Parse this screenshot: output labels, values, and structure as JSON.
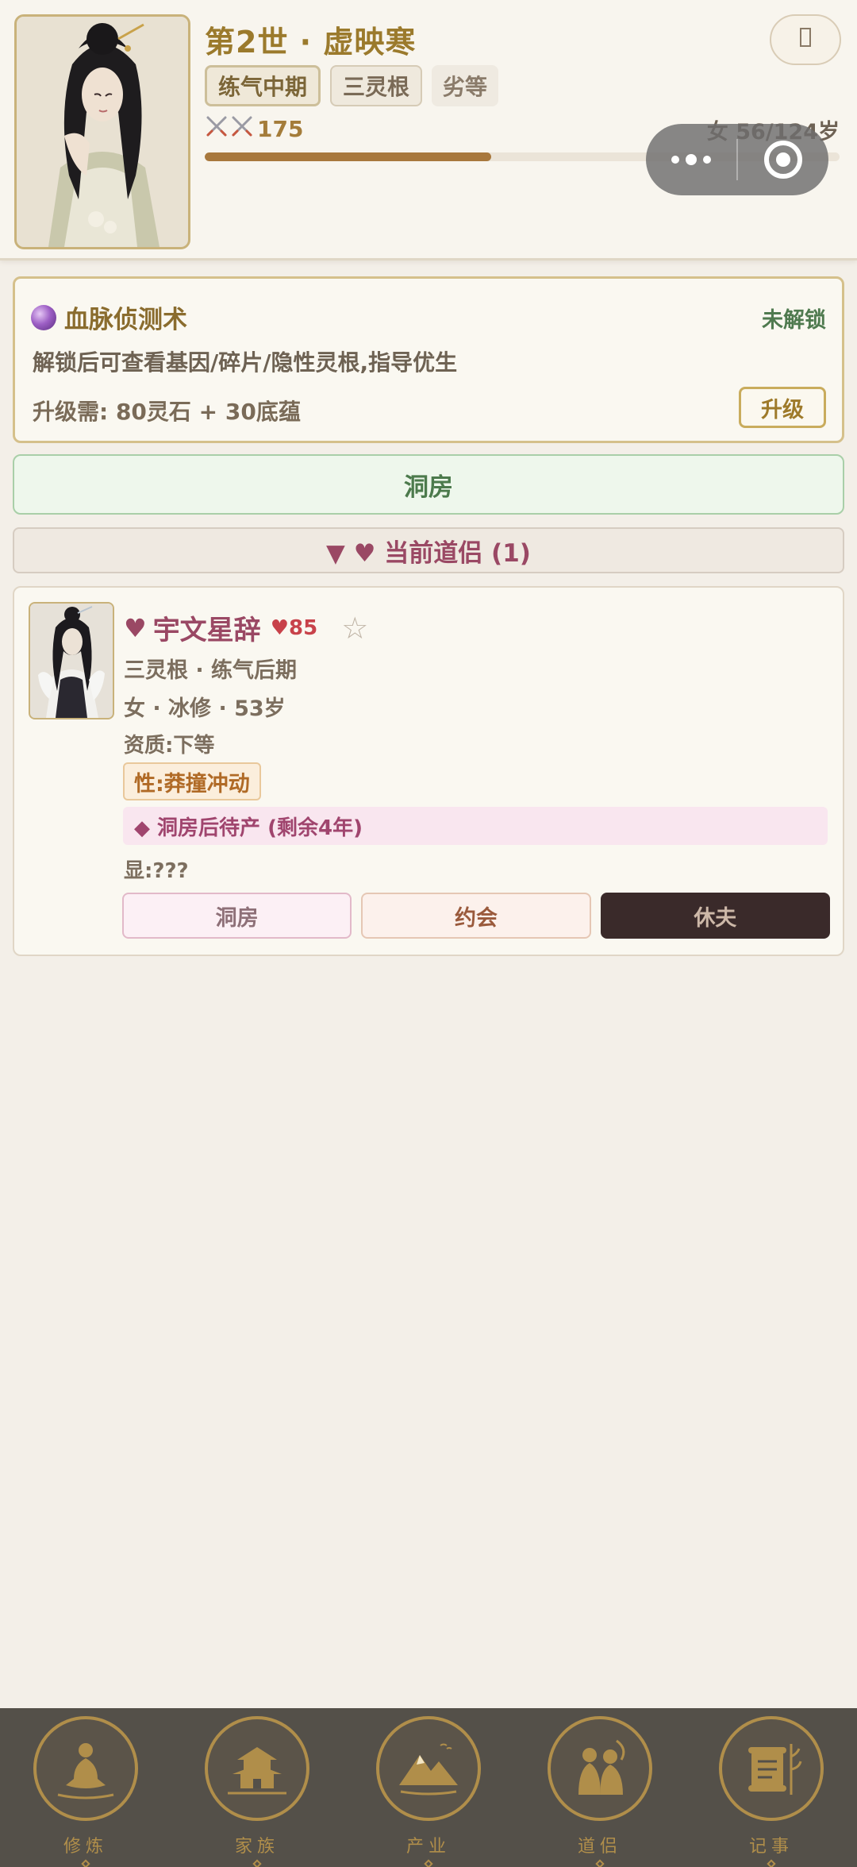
{
  "header": {
    "generation_title": "第2世 · 虚映寒",
    "realm": "练气中期",
    "spirit_root": "三灵根",
    "grade": "劣等",
    "power": "175",
    "power_icon": "crossed-swords-icon",
    "age_text": "女 56/124岁",
    "age_progress": 0.4516,
    "menu_icon": "menu-icon",
    "capsule_more_icon": "more-dots-icon",
    "capsule_close_icon": "target-close-icon"
  },
  "bloodline": {
    "title": "血脉侦测术",
    "status": "未解锁",
    "description": "解锁后可查看基因/碎片/隐性灵根,指导优生",
    "cost": "升级需: 80灵石 + 30底蕴",
    "upgrade_label": "升级",
    "icon": "crystal-ball-icon"
  },
  "bridal_button": "洞房",
  "section": {
    "label": "▼ ♥ 当前道侣 (1)"
  },
  "partner": {
    "heart": "♥",
    "name": "宇文星辞",
    "favor": "♥85",
    "star": "☆",
    "roots_realm": "三灵根 · 练气后期",
    "profile": "女 · 冰修 · 53岁",
    "aptitude": "资质:下等",
    "trait": "性:莽撞冲动",
    "pregnancy": "◆ 洞房后待产 (剩余4年)",
    "hidden": "显:???",
    "actions": {
      "bridal": "洞房",
      "date": "约会",
      "divorce": "休夫"
    }
  },
  "nav": [
    {
      "label": "修炼",
      "icon": "meditation-icon"
    },
    {
      "label": "家族",
      "icon": "pavilion-icon"
    },
    {
      "label": "产业",
      "icon": "mountain-icon"
    },
    {
      "label": "道侣",
      "icon": "couple-icon"
    },
    {
      "label": "记事",
      "icon": "scroll-icon"
    }
  ],
  "colors": {
    "gold": "#9b7a2c",
    "rose": "#9a4864",
    "green": "#4c7a4c",
    "nav_bg": "#545049"
  }
}
